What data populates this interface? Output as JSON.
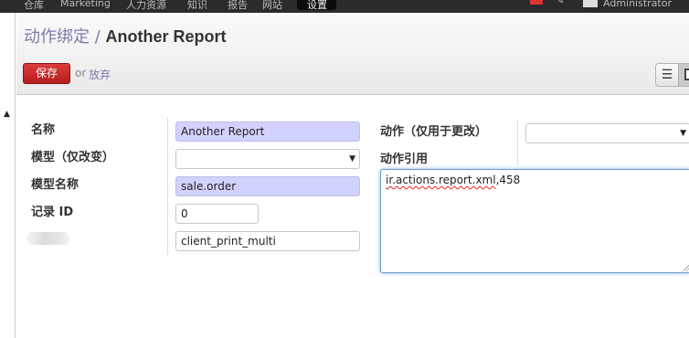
{
  "topbar": {
    "menu": [
      "仓库",
      "Marketing",
      "人力资源",
      "知识",
      "报告",
      "网站",
      "设置"
    ],
    "active_menu": "设置",
    "user": "Administrator"
  },
  "breadcrumb": {
    "parent": "动作绑定",
    "separator": " / ",
    "current": "Another Report"
  },
  "toolbar": {
    "save_label": "保存",
    "or_label": "or",
    "discard_label": "放弃",
    "views": [
      "list",
      "form"
    ],
    "active_view": "form"
  },
  "form": {
    "name_label": "名称",
    "name_value": "Another Report",
    "model_label": "模型（仅改变）",
    "model_value": "",
    "model_name_label": "模型名称",
    "model_name_value": "sale.order",
    "record_id_label": "记录 ID",
    "record_id_value": "0",
    "key2_value": "client_print_multi",
    "action_label": "动作（仅用于更改）",
    "action_value": "",
    "action_ref_label": "动作引用",
    "action_ref_value_prefix": "ir.actions.report.xml",
    "action_ref_value_suffix": ",458"
  },
  "colors": {
    "required_field": "#d2d2ff",
    "save_button": "#c82828",
    "link": "#7c7bad",
    "focus_border": "#6f9bd1"
  }
}
